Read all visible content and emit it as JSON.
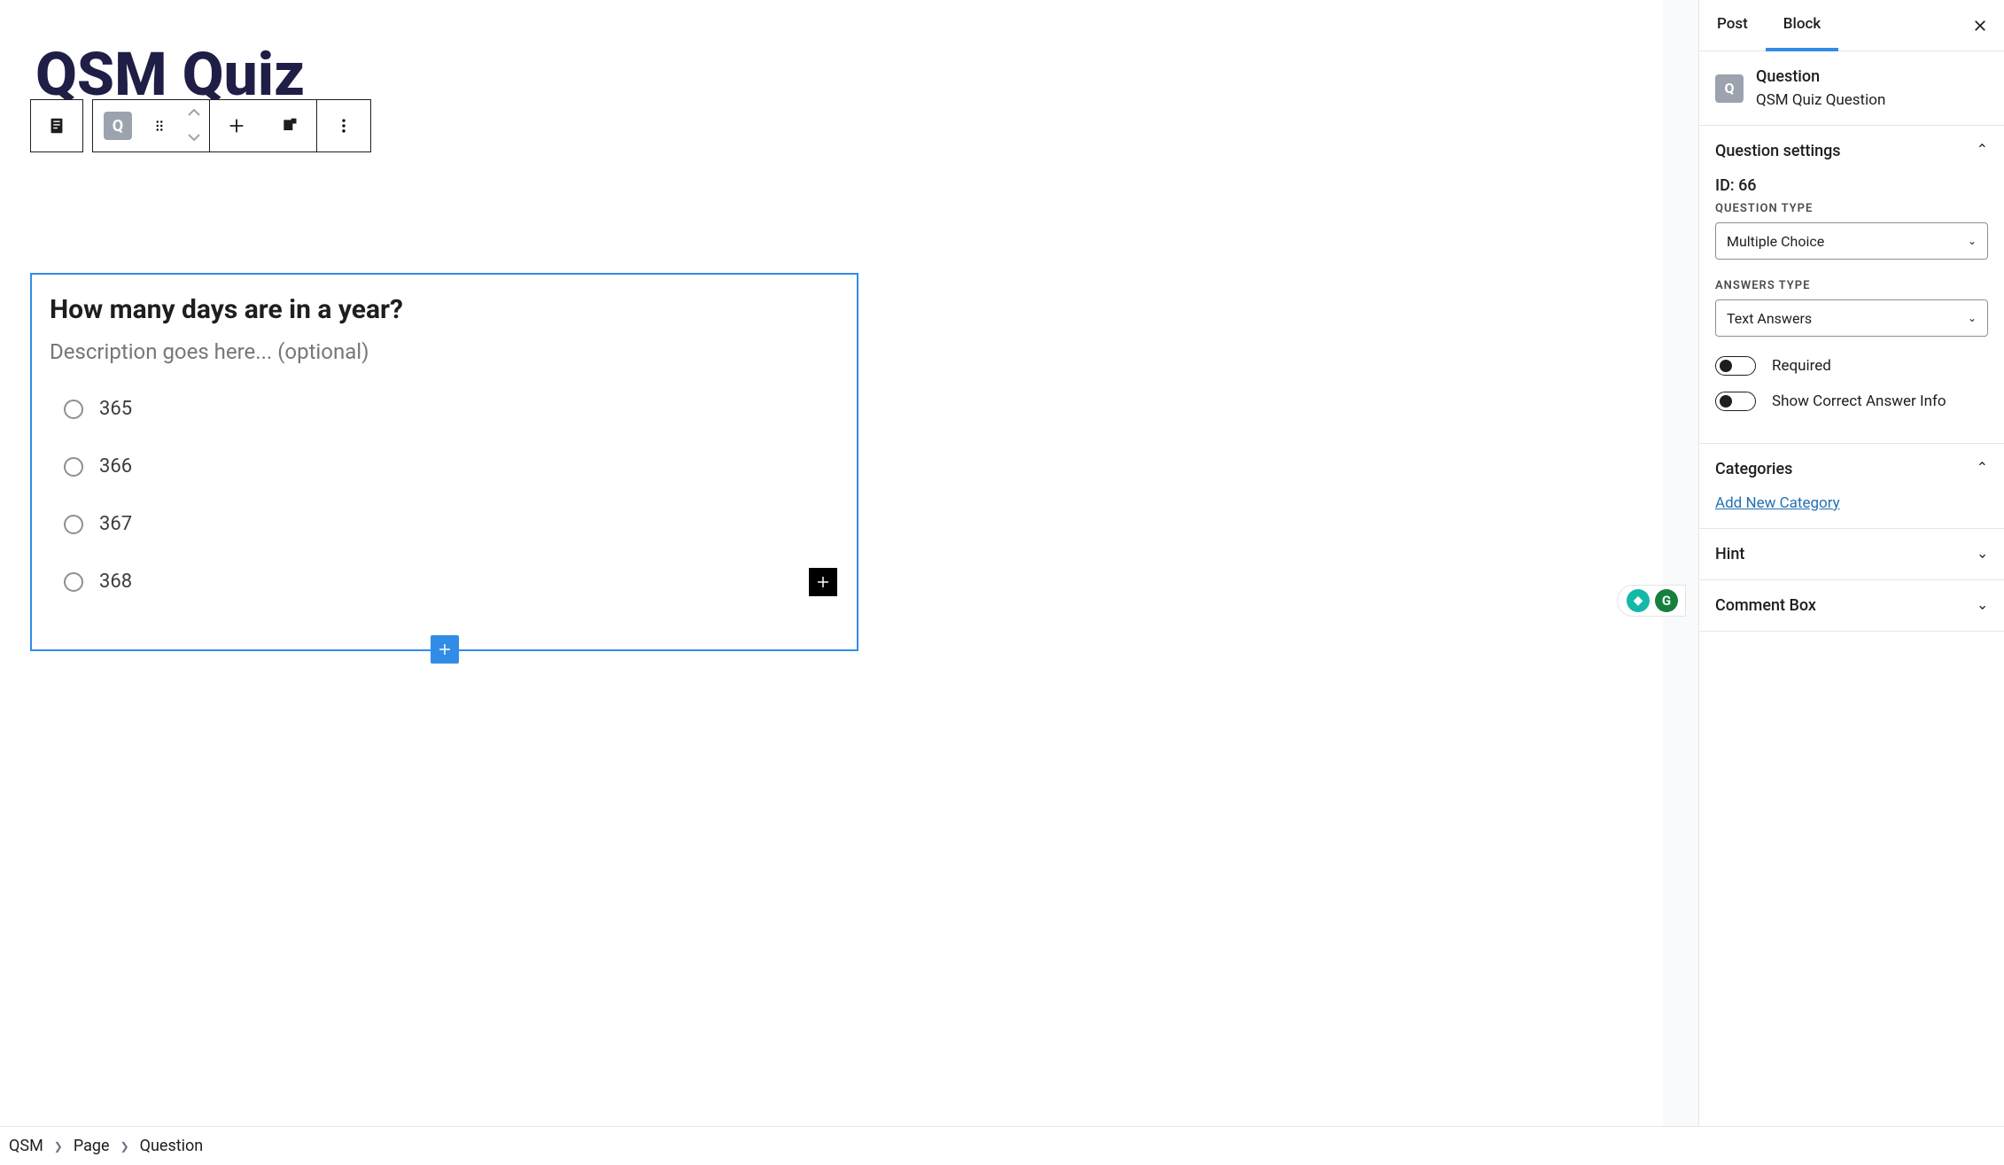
{
  "page_title": "QSM Quiz",
  "toolbar": {
    "icons": [
      "document-icon",
      "question-block-icon",
      "drag-icon",
      "move-up-icon",
      "move-down-icon",
      "add-icon",
      "copy-icon",
      "more-icon"
    ]
  },
  "question": {
    "title": "How many days are in a year?",
    "description_placeholder": "Description goes here... (optional)",
    "answers": [
      "365",
      "366",
      "367",
      "368"
    ]
  },
  "sidebar": {
    "tabs": {
      "post": "Post",
      "block": "Block",
      "active": "block"
    },
    "block": {
      "icon_letter": "Q",
      "name": "Question",
      "sub": "QSM Quiz Question"
    },
    "panels": {
      "question_settings": {
        "title": "Question settings",
        "id_label": "ID: 66",
        "question_type_label": "QUESTION TYPE",
        "question_type_value": "Multiple Choice",
        "answers_type_label": "ANSWERS TYPE",
        "answers_type_value": "Text Answers",
        "toggles": {
          "required": "Required",
          "show_correct": "Show Correct Answer Info"
        }
      },
      "categories": {
        "title": "Categories",
        "add_link": "Add New Category"
      },
      "hint": {
        "title": "Hint"
      },
      "comment_box": {
        "title": "Comment Box"
      }
    }
  },
  "breadcrumb": [
    "QSM",
    "Page",
    "Question"
  ]
}
